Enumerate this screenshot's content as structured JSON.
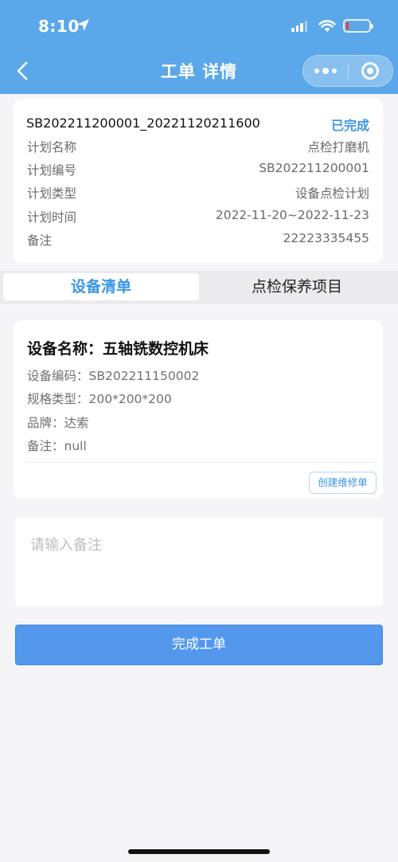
{
  "status_bar": {
    "time": "8:10"
  },
  "nav": {
    "title": "工单 详情"
  },
  "order": {
    "number": "SB202211200001_20221120211600",
    "status": "已完成",
    "status_color": "#3b96e8",
    "fields": [
      {
        "label": "计划名称",
        "value": "点检打磨机"
      },
      {
        "label": "计划编号",
        "value": "SB202211200001"
      },
      {
        "label": "计划类型",
        "value": "设备点检计划"
      },
      {
        "label": "计划时间",
        "value": "2022-11-20~2022-11-23"
      },
      {
        "label": "备注",
        "value": "22223335455"
      }
    ]
  },
  "tabs": [
    {
      "label": "设备清单",
      "active": true
    },
    {
      "label": "点检保养项目",
      "active": false
    }
  ],
  "device": {
    "title": "设备名称：五轴铣数控机床",
    "rows": [
      "设备编码：SB202211150002",
      "规格类型：200*200*200",
      "品牌：达索",
      "备注：null"
    ],
    "repair_button": "创建维修单"
  },
  "remark": {
    "placeholder": "请输入备注"
  },
  "complete_button": "完成工单",
  "colors": {
    "header": "#5aa8ea",
    "accent": "#3b96e8",
    "primary_button": "#5498ee"
  }
}
